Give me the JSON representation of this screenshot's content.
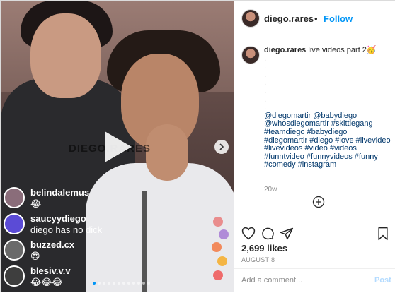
{
  "media": {
    "watermark": "DIEGO.RARES",
    "live_comments": [
      {
        "user": "belindalemus",
        "text": "😂",
        "avatar_color": "#8a6d7a"
      },
      {
        "user": "saucyydiego",
        "text": "diego has no dick",
        "avatar_color": "#5b4bd6"
      },
      {
        "user": "buzzed.cx",
        "text": "😍",
        "avatar_color": "#6a6a6a"
      },
      {
        "user": "blesiv.v.v",
        "text": "😂😂😂",
        "avatar_color": "#3e3e3e"
      }
    ],
    "carousel_dots": 12,
    "active_dot": 0
  },
  "header": {
    "username": "diego.rares",
    "separator": "•",
    "follow_label": "Follow"
  },
  "caption": {
    "username": "diego.rares",
    "title": "live videos part 2🥳",
    "dots": [
      ".",
      ".",
      ".",
      ".",
      ".",
      ".",
      "."
    ],
    "hashtags": "@diegomartir @babydiego @whosdiegomartir #skittlegang #teamdiego #babydiego #diegomartir #diego #love #livevideo #livevideos #video #videos #funntvideo #funnyvideos #funny #comedy #instagram",
    "age": "20w"
  },
  "actions": {
    "likes": "2,699 likes",
    "date": "AUGUST 8",
    "comment_placeholder": "Add a comment...",
    "post_label": "Post"
  },
  "colors": {
    "link": "#00376b",
    "follow": "#0095f6",
    "muted": "#8e8e8e"
  }
}
